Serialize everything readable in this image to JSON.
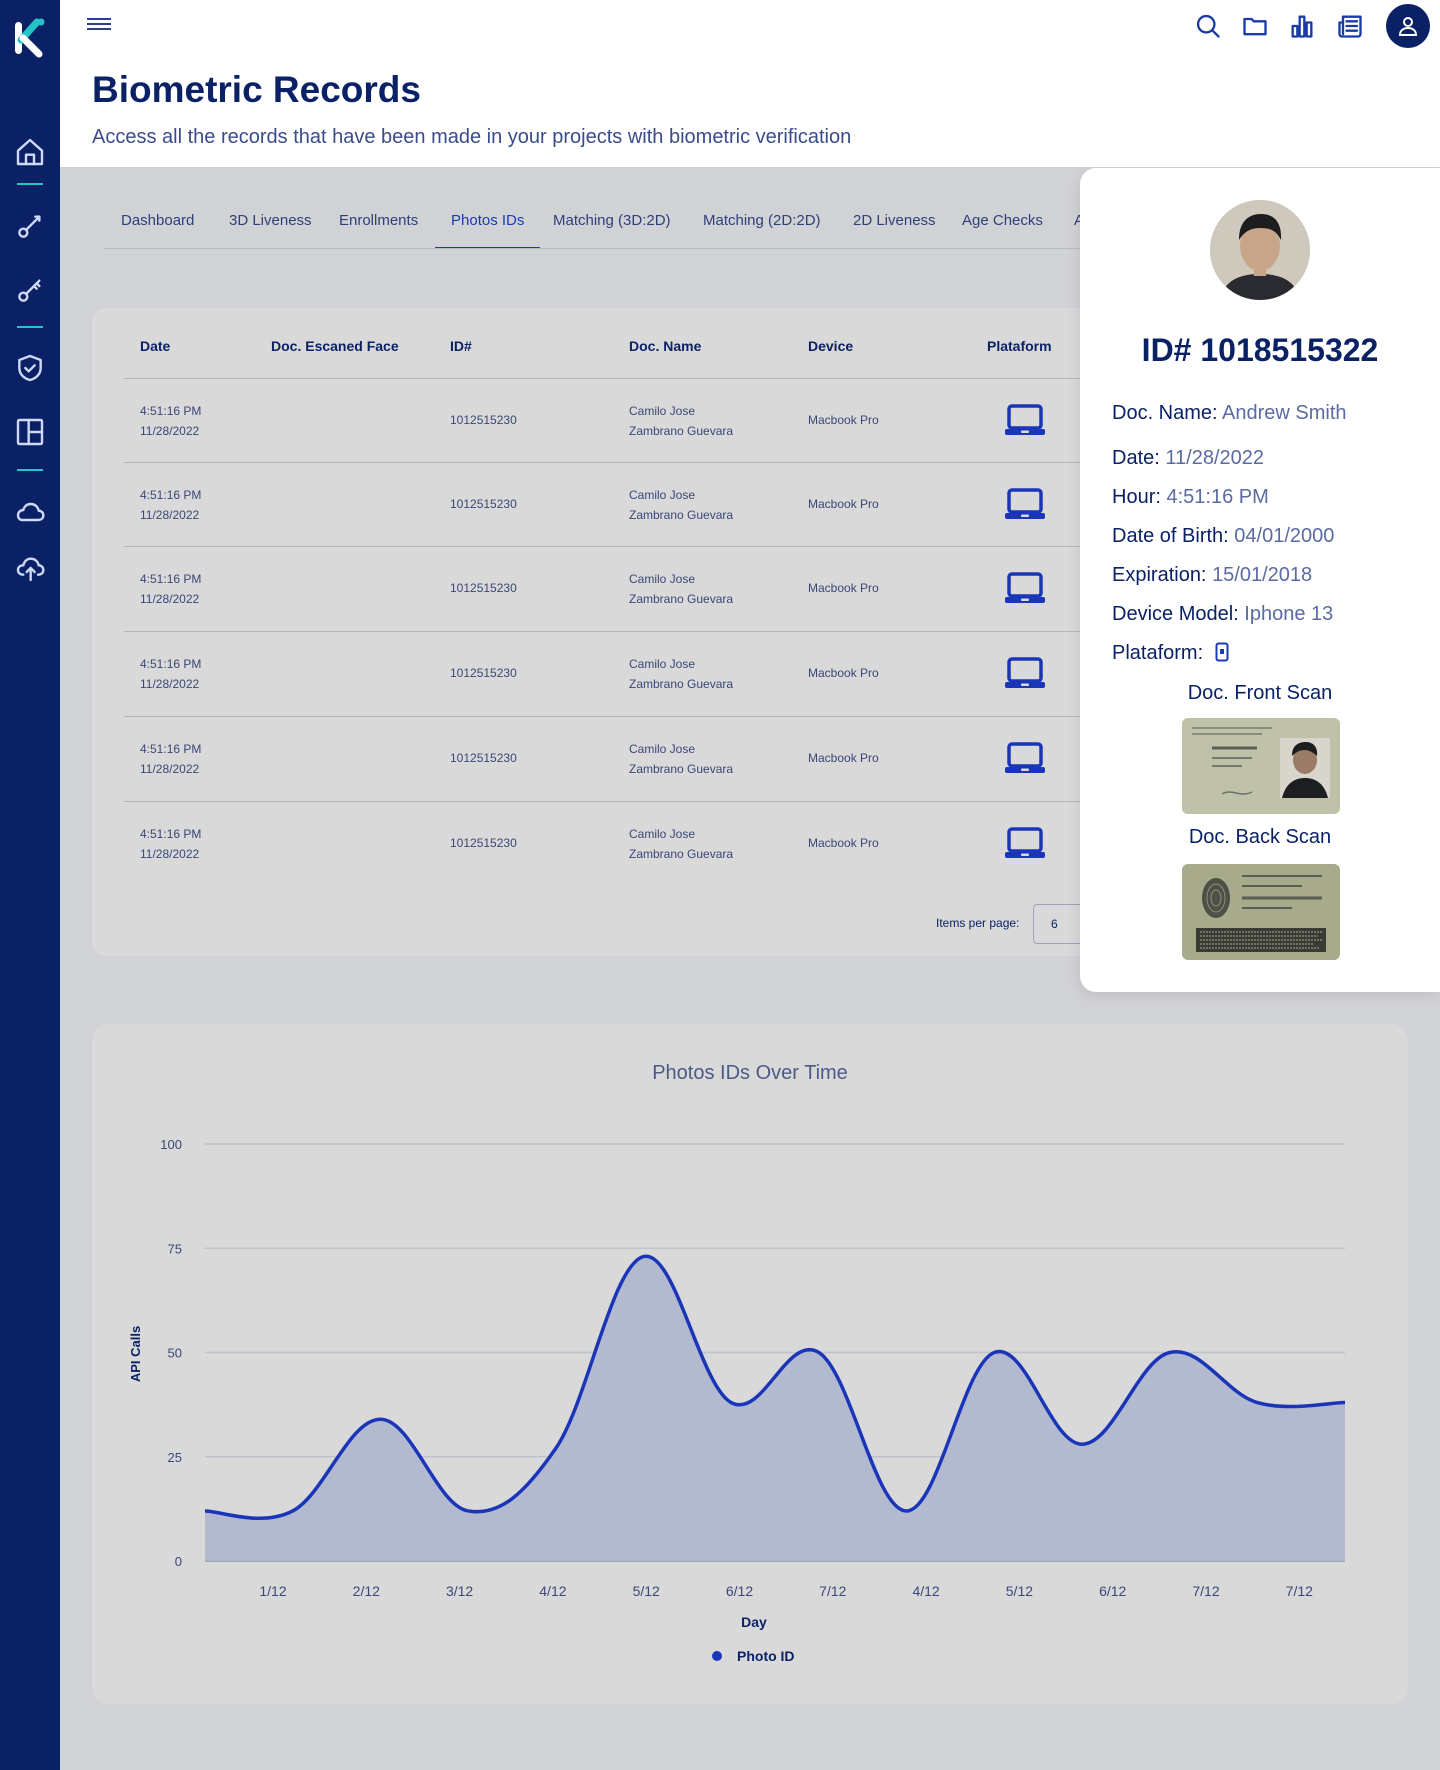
{
  "header": {
    "title": "Biometric Records",
    "subtitle": "Access all the records that have been made in your projects with biometric verification"
  },
  "tabs": [
    {
      "label": "Dashboard"
    },
    {
      "label": "3D Liveness"
    },
    {
      "label": "Enrollments"
    },
    {
      "label": "Photos IDs",
      "active": true
    },
    {
      "label": "Matching (3D:2D)"
    },
    {
      "label": "Matching (2D:2D)"
    },
    {
      "label": "2D Liveness"
    },
    {
      "label": "Age Checks"
    },
    {
      "label": "A"
    }
  ],
  "table": {
    "columns": [
      "Date",
      "Doc. Escaned Face",
      "ID#",
      "Doc. Name",
      "Device",
      "Plataform"
    ],
    "rows": [
      {
        "time": "4:51:16 PM",
        "date": "11/28/2022",
        "id": "1012515230",
        "name1": "Camilo Jose",
        "name2": "Zambrano Guevara",
        "device": "Macbook Pro",
        "platform": "laptop-icon"
      },
      {
        "time": "4:51:16 PM",
        "date": "11/28/2022",
        "id": "1012515230",
        "name1": "Camilo Jose",
        "name2": "Zambrano Guevara",
        "device": "Macbook Pro",
        "platform": "laptop-icon"
      },
      {
        "time": "4:51:16 PM",
        "date": "11/28/2022",
        "id": "1012515230",
        "name1": "Camilo Jose",
        "name2": "Zambrano Guevara",
        "device": "Macbook Pro",
        "platform": "laptop-icon"
      },
      {
        "time": "4:51:16 PM",
        "date": "11/28/2022",
        "id": "1012515230",
        "name1": "Camilo Jose",
        "name2": "Zambrano Guevara",
        "device": "Macbook Pro",
        "platform": "laptop-icon"
      },
      {
        "time": "4:51:16 PM",
        "date": "11/28/2022",
        "id": "1012515230",
        "name1": "Camilo Jose",
        "name2": "Zambrano Guevara",
        "device": "Macbook Pro",
        "platform": "laptop-icon"
      },
      {
        "time": "4:51:16 PM",
        "date": "11/28/2022",
        "id": "1012515230",
        "name1": "Camilo Jose",
        "name2": "Zambrano Guevara",
        "device": "Macbook Pro",
        "platform": "laptop-icon"
      }
    ],
    "pager": {
      "label": "Items per page:",
      "value": "6"
    }
  },
  "detail": {
    "id_title": "ID# 1018515322",
    "doc_name_label": "Doc. Name:",
    "doc_name": "Andrew Smith",
    "date_label": "Date:",
    "date": "11/28/2022",
    "hour_label": "Hour:",
    "hour": "4:51:16 PM",
    "dob_label": "Date of Birth:",
    "dob": "04/01/2000",
    "exp_label": "Expiration:",
    "exp": "15/01/2018",
    "model_label": "Device Model:",
    "model": "Iphone 13",
    "platform_label": "Plataform:",
    "platform_icon": "phone-icon",
    "front_label": "Doc. Front Scan",
    "back_label": "Doc. Back Scan"
  },
  "colors": {
    "sidebar": "#0a2166",
    "accent": "#1b3bb5",
    "teal": "#25c4c7",
    "series": "#1a35b8",
    "area": "#b1b8cf"
  },
  "chart_data": {
    "type": "area",
    "title": "Photos IDs Over Time",
    "xlabel": "Day",
    "ylabel": "API Calls",
    "ylim": [
      0,
      100
    ],
    "yticks": [
      0,
      25,
      50,
      75,
      100
    ],
    "categories": [
      "1/12",
      "2/12",
      "3/12",
      "4/12",
      "5/12",
      "6/12",
      "7/12",
      "4/12",
      "5/12",
      "6/12",
      "7/12",
      "7/12"
    ],
    "series": [
      {
        "name": "Photo ID",
        "values": [
          12,
          12,
          34,
          12,
          27,
          73,
          38,
          50,
          12,
          50,
          28,
          50,
          38,
          38
        ]
      }
    ],
    "grid": true,
    "legend": "bottom-center"
  }
}
